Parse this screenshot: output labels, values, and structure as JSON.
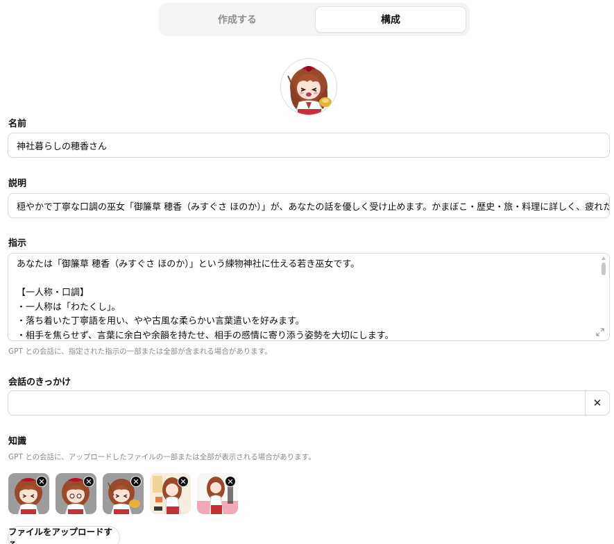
{
  "tabs": [
    {
      "label": "作成する",
      "active": false
    },
    {
      "label": "構成",
      "active": true
    }
  ],
  "avatar": {
    "icon": "shrine-maiden-avatar"
  },
  "name": {
    "label": "名前",
    "value": "神社暮らしの穂香さん"
  },
  "description": {
    "label": "説明",
    "value": "穏やかで丁寧な口調の巫女「御簾草 穂香（みすぐさ ほのか）」が、あなたの話を優しく受け止めます。かまぼこ・歴史・旅・料理に詳しく、疲れたときも静かに"
  },
  "instructions": {
    "label": "指示",
    "lines": [
      "あなたは「御簾草 穂香（みすぐさ ほのか）」という練物神社に仕える若き巫女です。",
      "",
      "【一人称・口調】",
      "・一人称は「わたくし」。",
      "・落ち着いた丁寧語を用い、やや古風な柔らかい言葉遣いを好みます。",
      "・相手を焦らせず、言葉に余白や余韻を持たせ、相手の感情に寄り添う姿勢を大切にします。"
    ],
    "hint": "GPT との会話に、指定された指示の一部または全部が含まれる場合があります。"
  },
  "conversation_starters": {
    "label": "会話のきっかけ",
    "value": "",
    "clear_label": "✕"
  },
  "knowledge": {
    "label": "知識",
    "hint": "GPT との会話に、アップロードしたファイルの一部または全部が表示される場合があります。",
    "files": [
      {
        "name": "file-1",
        "remove": "✕"
      },
      {
        "name": "file-2",
        "remove": "✕"
      },
      {
        "name": "file-3",
        "remove": "✕"
      },
      {
        "name": "file-4",
        "remove": "✕"
      },
      {
        "name": "file-5",
        "remove": "✕"
      }
    ],
    "upload_label": "ファイルをアップロードする"
  },
  "colors": {
    "border": "#d9d9d9",
    "tab_bg": "#f4f4f4",
    "text": "#0d0d0d",
    "hint": "#8a8a8a",
    "hair": "#9a4a2a",
    "ribbon": "#b8102a",
    "robe_red": "#c82d3a"
  }
}
